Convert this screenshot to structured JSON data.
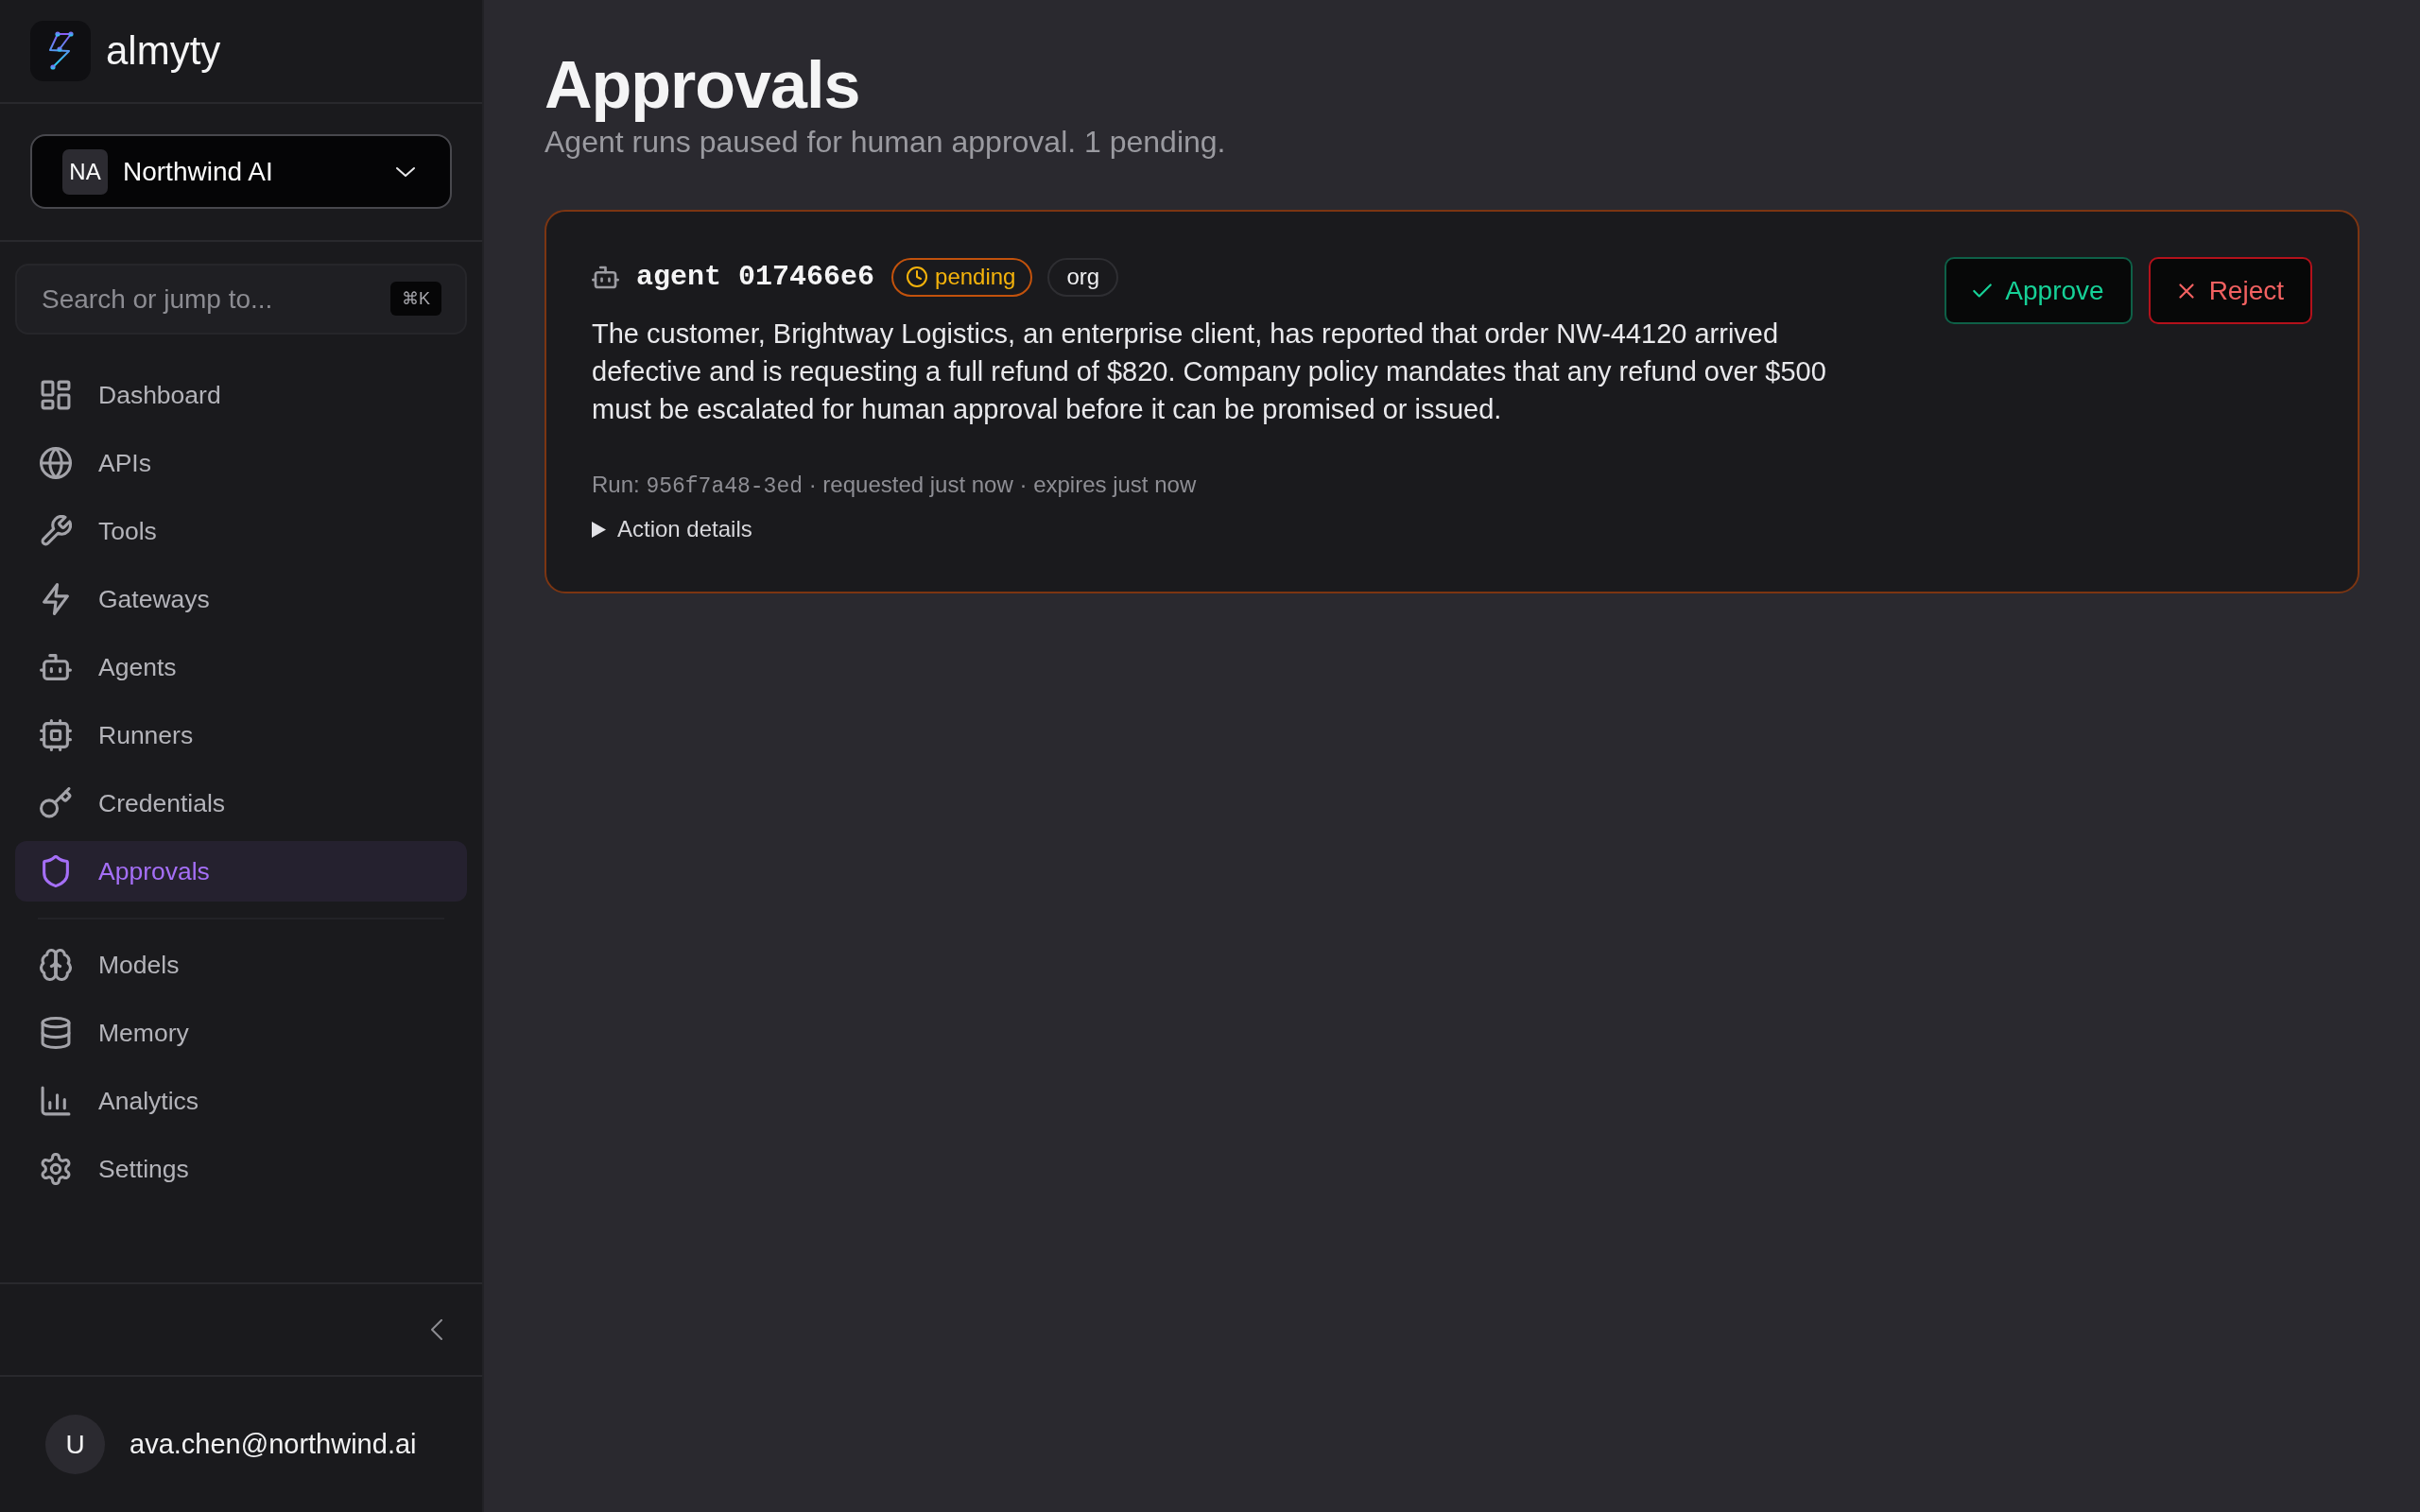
{
  "sidebar": {
    "brand": {
      "name": "almyty"
    },
    "org_selector": {
      "initials": "NA",
      "name": "Northwind AI"
    },
    "search": {
      "placeholder": "Search or jump to...",
      "shortcut": "⌘K"
    },
    "nav_sections": [
      {
        "items": [
          {
            "label": "Dashboard",
            "selected": false
          },
          {
            "label": "APIs",
            "selected": false
          },
          {
            "label": "Tools",
            "selected": false
          },
          {
            "label": "Gateways",
            "selected": false
          },
          {
            "label": "Agents",
            "selected": false
          },
          {
            "label": "Runners",
            "selected": false
          },
          {
            "label": "Credentials",
            "selected": false
          },
          {
            "label": "Approvals",
            "selected": true
          }
        ]
      },
      {
        "items": [
          {
            "label": "Models",
            "selected": false
          },
          {
            "label": "Memory",
            "selected": false
          },
          {
            "label": "Analytics",
            "selected": false
          },
          {
            "label": "Settings",
            "selected": false
          }
        ]
      }
    ],
    "user": {
      "initial": "U",
      "email": "ava.chen@northwind.ai"
    }
  },
  "page": {
    "title": "Approvals",
    "subtitle": "Agent runs paused for human approval. 1 pending."
  },
  "approvals": [
    {
      "agent": "agent 017466e6",
      "status": {
        "label": "pending",
        "kind": "pending"
      },
      "scope": "org",
      "description": "The customer, Brightway Logistics, an enterprise client, has reported that order NW-44120 arrived defective and is requesting a full refund of $820. Company policy mandates that any refund over $500 must be escalated for human approval before it can be promised or issued.",
      "run_label": "Run:",
      "run_id": "956f7a48-3ed",
      "run_details": "· requested just now · expires just now",
      "details_toggle": {
        "label": "Action details",
        "expanded": false
      },
      "actions": [
        {
          "label": "Approve",
          "kind": "approve"
        },
        {
          "label": "Reject",
          "kind": "reject"
        }
      ]
    }
  ]
}
